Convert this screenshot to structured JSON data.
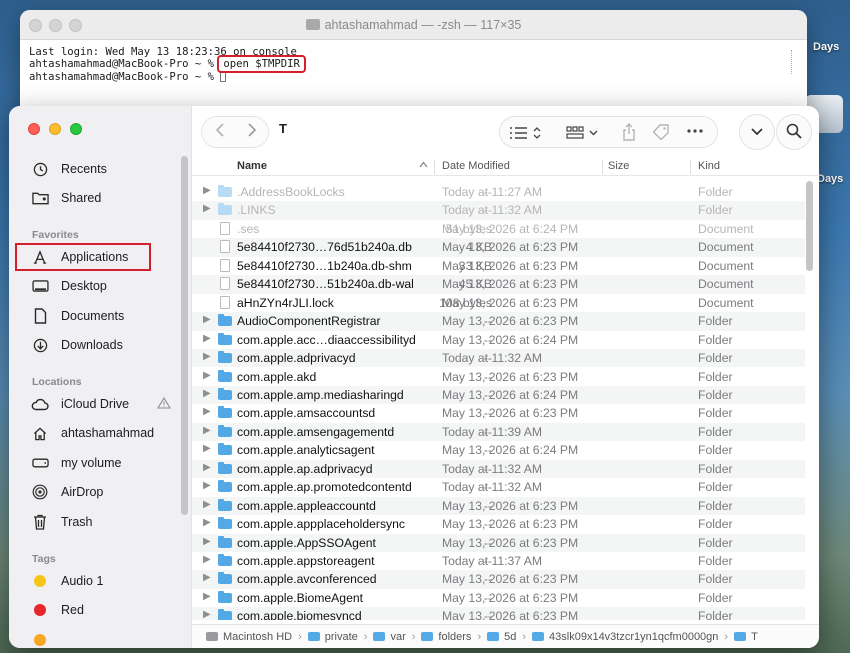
{
  "desktop": {
    "labels": [
      "Days",
      "Days"
    ]
  },
  "terminal": {
    "title": "ahtashamahmad — -zsh — 117×35",
    "lines": {
      "login": "Last login: Wed May 13 18:23:36 on console",
      "prompt1": "ahtashamahmad@MacBook-Pro ~ % ",
      "command": "open $TMPDIR",
      "prompt2": "ahtashamahmad@MacBook-Pro ~ % "
    }
  },
  "finder": {
    "title": "T",
    "sidebar": {
      "top_items": [
        {
          "label": "Recents",
          "icon": "clock-icon"
        },
        {
          "label": "Shared",
          "icon": "shared-folder-icon"
        }
      ],
      "favorites_title": "Favorites",
      "favorites": [
        {
          "label": "Applications",
          "icon": "applications-icon"
        },
        {
          "label": "Desktop",
          "icon": "desktop-icon"
        },
        {
          "label": "Documents",
          "icon": "document-icon"
        },
        {
          "label": "Downloads",
          "icon": "download-icon"
        }
      ],
      "locations_title": "Locations",
      "locations": [
        {
          "label": "iCloud Drive",
          "icon": "cloud-icon"
        },
        {
          "label": "ahtashamahmad",
          "icon": "home-icon"
        },
        {
          "label": "my volume",
          "icon": "drive-icon"
        },
        {
          "label": "AirDrop",
          "icon": "airdrop-icon"
        },
        {
          "label": "Trash",
          "icon": "trash-icon"
        }
      ],
      "tags_title": "Tags",
      "tags": [
        {
          "label": "Audio 1",
          "color": "#f5c518"
        },
        {
          "label": "Red",
          "color": "#e8262c"
        }
      ]
    },
    "columns": {
      "name": "Name",
      "date": "Date Modified",
      "size": "Size",
      "kind": "Kind"
    },
    "rows": [
      {
        "name": ".AddressBookLocks",
        "date": "Today at 11:27 AM",
        "size": "--",
        "kind": "Folder",
        "type": "folder",
        "dim": true
      },
      {
        "name": ".LINKS",
        "date": "Today at 11:32 AM",
        "size": "--",
        "kind": "Folder",
        "type": "folder",
        "dim": true
      },
      {
        "name": ".ses",
        "date": "May 13, 2026 at 6:24 PM",
        "size": "51 bytes",
        "kind": "Document",
        "type": "doc",
        "dim": true
      },
      {
        "name": "5e84410f2730…76d51b240a.db",
        "date": "May 13, 2026 at 6:23 PM",
        "size": "4 KB",
        "kind": "Document",
        "type": "doc"
      },
      {
        "name": "5e84410f2730…1b240a.db-shm",
        "date": "May 13, 2026 at 6:23 PM",
        "size": "33 KB",
        "kind": "Document",
        "type": "doc"
      },
      {
        "name": "5e84410f2730…51b240a.db-wal",
        "date": "May 13, 2026 at 6:23 PM",
        "size": "45 KB",
        "kind": "Document",
        "type": "doc"
      },
      {
        "name": "aHnZYn4rJLI.lock",
        "date": "May 13, 2026 at 6:23 PM",
        "size": "108 bytes",
        "kind": "Document",
        "type": "doc"
      },
      {
        "name": "AudioComponentRegistrar",
        "date": "May 13, 2026 at 6:23 PM",
        "size": "--",
        "kind": "Folder",
        "type": "folder"
      },
      {
        "name": "com.apple.acc…diaaccessibilityd",
        "date": "May 13, 2026 at 6:24 PM",
        "size": "--",
        "kind": "Folder",
        "type": "folder"
      },
      {
        "name": "com.apple.adprivacyd",
        "date": "Today at 11:32 AM",
        "size": "--",
        "kind": "Folder",
        "type": "folder"
      },
      {
        "name": "com.apple.akd",
        "date": "May 13, 2026 at 6:23 PM",
        "size": "--",
        "kind": "Folder",
        "type": "folder"
      },
      {
        "name": "com.apple.amp.mediasharingd",
        "date": "May 13, 2026 at 6:24 PM",
        "size": "--",
        "kind": "Folder",
        "type": "folder"
      },
      {
        "name": "com.apple.amsaccountsd",
        "date": "May 13, 2026 at 6:23 PM",
        "size": "--",
        "kind": "Folder",
        "type": "folder"
      },
      {
        "name": "com.apple.amsengagementd",
        "date": "Today at 11:39 AM",
        "size": "--",
        "kind": "Folder",
        "type": "folder"
      },
      {
        "name": "com.apple.analyticsagent",
        "date": "May 13, 2026 at 6:24 PM",
        "size": "--",
        "kind": "Folder",
        "type": "folder"
      },
      {
        "name": "com.apple.ap.adprivacyd",
        "date": "Today at 11:32 AM",
        "size": "--",
        "kind": "Folder",
        "type": "folder"
      },
      {
        "name": "com.apple.ap.promotedcontentd",
        "date": "Today at 11:32 AM",
        "size": "--",
        "kind": "Folder",
        "type": "folder"
      },
      {
        "name": "com.apple.appleaccountd",
        "date": "May 13, 2026 at 6:23 PM",
        "size": "--",
        "kind": "Folder",
        "type": "folder"
      },
      {
        "name": "com.apple.appplaceholdersync",
        "date": "May 13, 2026 at 6:23 PM",
        "size": "--",
        "kind": "Folder",
        "type": "folder"
      },
      {
        "name": "com.apple.AppSSOAgent",
        "date": "May 13, 2026 at 6:23 PM",
        "size": "--",
        "kind": "Folder",
        "type": "folder"
      },
      {
        "name": "com.apple.appstoreagent",
        "date": "Today at 11:37 AM",
        "size": "--",
        "kind": "Folder",
        "type": "folder"
      },
      {
        "name": "com.apple.avconferenced",
        "date": "May 13, 2026 at 6:23 PM",
        "size": "--",
        "kind": "Folder",
        "type": "folder"
      },
      {
        "name": "com.apple.BiomeAgent",
        "date": "May 13, 2026 at 6:23 PM",
        "size": "--",
        "kind": "Folder",
        "type": "folder"
      },
      {
        "name": "com.apple.biomesyncd",
        "date": "May 13, 2026 at 6:23 PM",
        "size": "--",
        "kind": "Folder",
        "type": "folder"
      }
    ],
    "path": [
      "Macintosh HD",
      "private",
      "var",
      "folders",
      "5d",
      "43slk09x14v3tzcr1yn1qcfm0000gn",
      "T"
    ]
  }
}
